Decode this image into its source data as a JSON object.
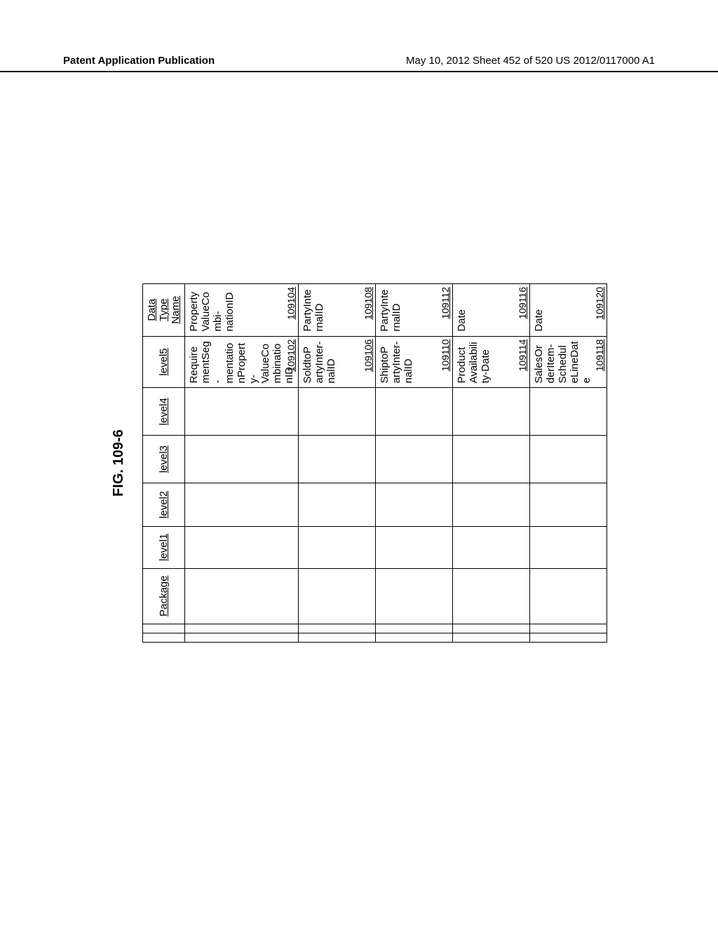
{
  "header": {
    "left": "Patent Application Publication",
    "right": "May 10, 2012  Sheet 452 of 520   US 2012/0117000 A1"
  },
  "figure": {
    "caption": "FIG. 109-6",
    "columns": [
      "Package",
      "level1",
      "level2",
      "level3",
      "level4",
      "level5",
      "Data Type Name"
    ],
    "rows": [
      {
        "level5": {
          "text": "RequirementSeg-mentationProperty-ValueCombinationID",
          "ref": "109102"
        },
        "dtype": {
          "text": "PropertyValueCombi-nationID",
          "ref": "109104"
        }
      },
      {
        "level5": {
          "text": "SoldtoPartyInter-nalID",
          "ref": "109106"
        },
        "dtype": {
          "text": "PartyInternalID",
          "ref": "109108"
        }
      },
      {
        "level5": {
          "text": "ShiptoPartyInter-nalID",
          "ref": "109110"
        },
        "dtype": {
          "text": "PartyInternalID",
          "ref": "109112"
        }
      },
      {
        "level5": {
          "text": "ProductAvailability-Date",
          "ref": "109114"
        },
        "dtype": {
          "text": "Date",
          "ref": "109116"
        }
      },
      {
        "level5": {
          "text": "SalesOrderItem-ScheduleLineDate",
          "ref": "109118"
        },
        "dtype": {
          "text": "Date",
          "ref": "109120"
        }
      }
    ]
  }
}
